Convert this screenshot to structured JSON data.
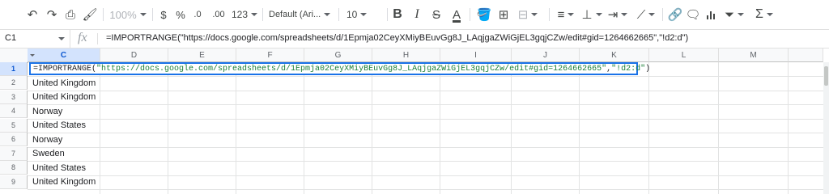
{
  "toolbar": {
    "zoom": "100%",
    "currency": "$",
    "percent": "%",
    "decimal_decrease": ".0",
    "decimal_increase": ".00",
    "number_format": "123",
    "font_family": "Default (Ari...",
    "font_size": "10",
    "bold": "B",
    "italic": "I",
    "strikethrough": "S",
    "text_color": "A",
    "function": "Σ"
  },
  "formula_bar": {
    "cell_ref": "C1",
    "fx": "fx",
    "formula": "=IMPORTRANGE(\"https://docs.google.com/spreadsheets/d/1Epmja02CeyXMiyBEuvGg8J_LAqjgaZWiGjEL3gqjCZw/edit#gid=1264662665\",\"!d2:d\")"
  },
  "grid": {
    "columns": [
      "C",
      "D",
      "E",
      "F",
      "G",
      "H",
      "I",
      "J",
      "K",
      "L",
      "M"
    ],
    "selected_column": "C",
    "rows": [
      {
        "num": "1",
        "value": ""
      },
      {
        "num": "2",
        "value": "United Kingdom"
      },
      {
        "num": "3",
        "value": "United Kingdom"
      },
      {
        "num": "4",
        "value": "Norway"
      },
      {
        "num": "5",
        "value": "United States"
      },
      {
        "num": "6",
        "value": "Norway"
      },
      {
        "num": "7",
        "value": "Sweden"
      },
      {
        "num": "8",
        "value": "United States"
      },
      {
        "num": "9",
        "value": "United Kingdom"
      }
    ]
  },
  "editor": {
    "prefix": "=IMPORTRANGE(",
    "url": "\"https://docs.google.com/spreadsheets/d/1Epmja02CeyXMiyBEuvGg8J_LAqjgaZWiGjEL3gqjCZw/edit#gid=1264662665\"",
    "comma": ",",
    "range": "\"!d2:d\"",
    "suffix": ")"
  },
  "colors": {
    "selection": "#1a73e8",
    "header_selected": "#d3e3fd",
    "string_green": "#1a7f37"
  }
}
